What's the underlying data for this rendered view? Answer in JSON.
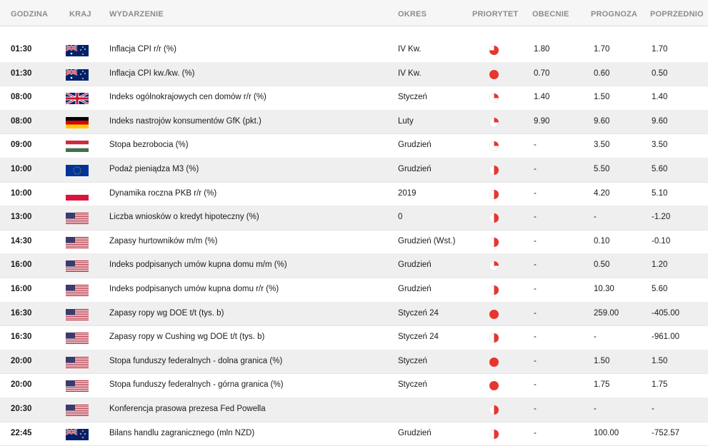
{
  "headers": {
    "time": "GODZINA",
    "country": "KRAJ",
    "event": "WYDARZENIE",
    "period": "OKRES",
    "priority": "PRIORYTET",
    "actual": "OBECNIE",
    "forecast": "PROGNOZA",
    "previous": "POPRZEDNIO"
  },
  "colors": {
    "priority_red": "#e8352e",
    "header_text": "#8c8c8c",
    "row_alt": "#efefef"
  },
  "rows": [
    {
      "time": "01:30",
      "flag": "australia-flag",
      "event": "Inflacja CPI r/r (%)",
      "period": "IV Kw.",
      "priority": "medium",
      "actual": "1.80",
      "forecast": "1.70",
      "previous": "1.70"
    },
    {
      "time": "01:30",
      "flag": "australia-flag",
      "event": "Inflacja CPI kw./kw. (%)",
      "period": "IV Kw.",
      "priority": "high",
      "actual": "0.70",
      "forecast": "0.60",
      "previous": "0.50"
    },
    {
      "time": "08:00",
      "flag": "uk-flag",
      "event": "Indeks ogólnokrajowych cen domów r/r (%)",
      "period": "Styczeń",
      "priority": "low",
      "actual": "1.40",
      "forecast": "1.50",
      "previous": "1.40"
    },
    {
      "time": "08:00",
      "flag": "germany-flag",
      "event": "Indeks nastrojów konsumentów GfK (pkt.)",
      "period": "Luty",
      "priority": "low",
      "actual": "9.90",
      "forecast": "9.60",
      "previous": "9.60"
    },
    {
      "time": "09:00",
      "flag": "hungary-flag",
      "event": "Stopa bezrobocia (%)",
      "period": "Grudzień",
      "priority": "low",
      "actual": "-",
      "forecast": "3.50",
      "previous": "3.50"
    },
    {
      "time": "10:00",
      "flag": "eu-flag",
      "event": "Podaż pieniądza M3 (%)",
      "period": "Grudzień",
      "priority": "half",
      "actual": "-",
      "forecast": "5.50",
      "previous": "5.60"
    },
    {
      "time": "10:00",
      "flag": "poland-flag",
      "event": "Dynamika roczna PKB r/r (%)",
      "period": "2019",
      "priority": "half",
      "actual": "-",
      "forecast": "4.20",
      "previous": "5.10"
    },
    {
      "time": "13:00",
      "flag": "usa-flag",
      "event": "Liczba wniosków o kredyt hipoteczny (%)",
      "period": "0",
      "priority": "half",
      "actual": "-",
      "forecast": "-",
      "previous": "-1.20"
    },
    {
      "time": "14:30",
      "flag": "usa-flag",
      "event": "Zapasy hurtowników m/m (%)",
      "period": "Grudzień (Wst.)",
      "priority": "half",
      "actual": "-",
      "forecast": "0.10",
      "previous": "-0.10"
    },
    {
      "time": "16:00",
      "flag": "usa-flag",
      "event": "Indeks podpisanych umów kupna domu m/m (%)",
      "period": "Grudzień",
      "priority": "low",
      "actual": "-",
      "forecast": "0.50",
      "previous": "1.20"
    },
    {
      "time": "16:00",
      "flag": "usa-flag",
      "event": "Indeks podpisanych umów kupna domu r/r (%)",
      "period": "Grudzień",
      "priority": "half",
      "actual": "-",
      "forecast": "10.30",
      "previous": "5.60"
    },
    {
      "time": "16:30",
      "flag": "usa-flag",
      "event": "Zapasy ropy wg DOE t/t (tys. b)",
      "period": "Styczeń 24",
      "priority": "high",
      "actual": "-",
      "forecast": "259.00",
      "previous": "-405.00"
    },
    {
      "time": "16:30",
      "flag": "usa-flag",
      "event": "Zapasy ropy w Cushing wg DOE t/t (tys. b)",
      "period": "Styczeń 24",
      "priority": "half",
      "actual": "-",
      "forecast": "-",
      "previous": "-961.00"
    },
    {
      "time": "20:00",
      "flag": "usa-flag",
      "event": "Stopa funduszy federalnych - dolna granica (%)",
      "period": "Styczeń",
      "priority": "high",
      "actual": "-",
      "forecast": "1.50",
      "previous": "1.50"
    },
    {
      "time": "20:00",
      "flag": "usa-flag",
      "event": "Stopa funduszy federalnych - górna granica (%)",
      "period": "Styczeń",
      "priority": "high",
      "actual": "-",
      "forecast": "1.75",
      "previous": "1.75"
    },
    {
      "time": "20:30",
      "flag": "usa-flag",
      "event": "Konferencja prasowa prezesa Fed Powella",
      "period": "",
      "priority": "half",
      "actual": "-",
      "forecast": "-",
      "previous": "-"
    },
    {
      "time": "22:45",
      "flag": "new-zealand-flag",
      "event": "Bilans handlu zagranicznego (mln NZD)",
      "period": "Grudzień",
      "priority": "half",
      "actual": "-",
      "forecast": "100.00",
      "previous": "-752.57"
    }
  ]
}
